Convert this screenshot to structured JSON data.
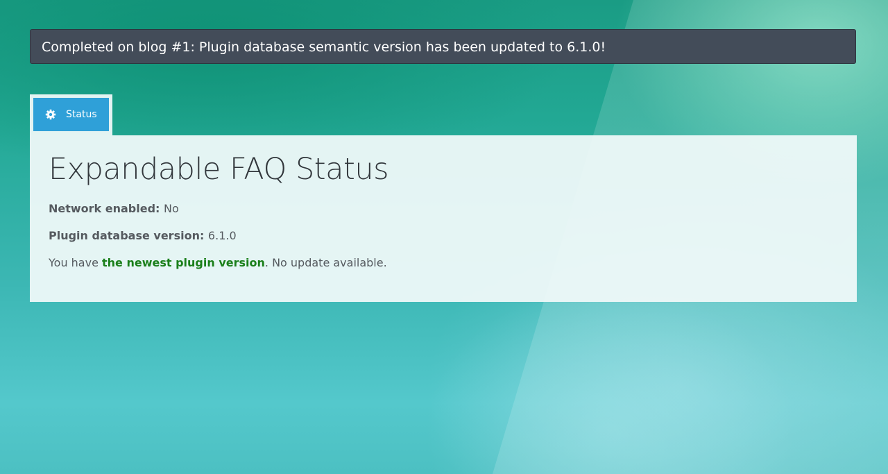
{
  "notice": {
    "text": "Completed on blog #1: Plugin database semantic version has been updated to 6.1.0!"
  },
  "tab": {
    "icon": "gear-icon",
    "label": "Status",
    "color": "#2fa0d8"
  },
  "status": {
    "title": "Expandable FAQ Status",
    "network_label": "Network enabled:",
    "network_value": "No",
    "db_version_label": "Plugin database version:",
    "db_version_value": "6.1.0",
    "version_prefix": "You have ",
    "version_highlight": "the newest plugin version",
    "version_suffix": ". No update available.",
    "highlight_color": "#1a7f1a"
  }
}
